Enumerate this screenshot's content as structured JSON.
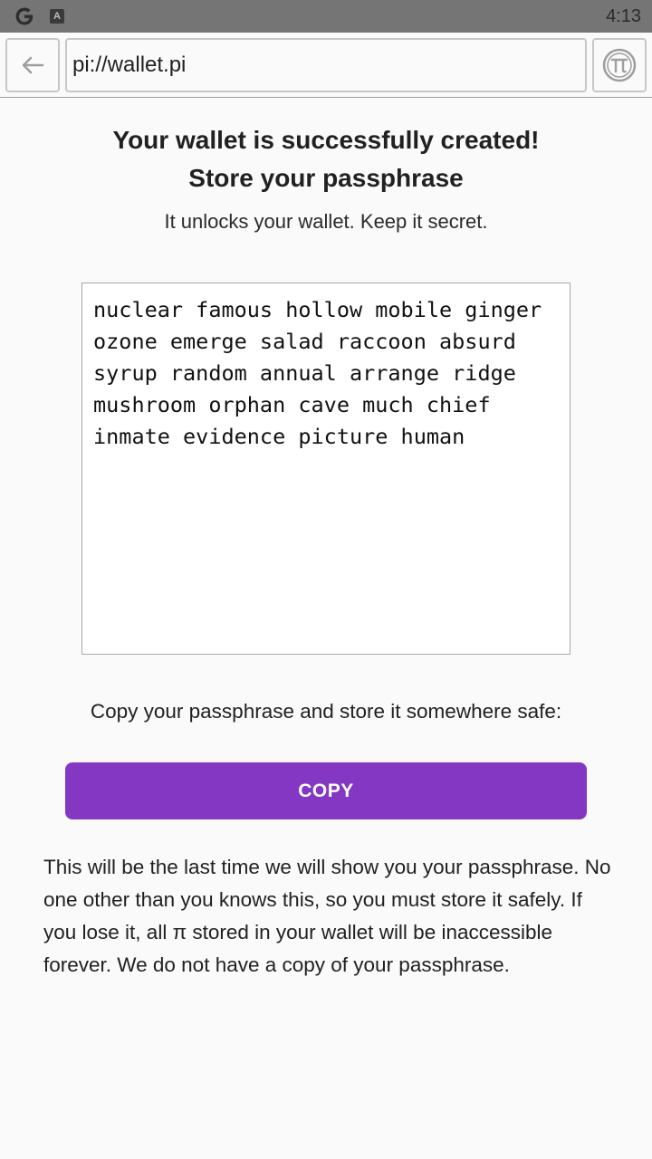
{
  "status_bar": {
    "time": "4:13",
    "icons": [
      "google-icon",
      "app-a-icon"
    ],
    "notif_letter": "A"
  },
  "browser": {
    "url": "pi://wallet.pi",
    "back_icon": "arrow-left-icon",
    "pi_icon": "pi-logo-icon"
  },
  "page": {
    "title_line1": "Your wallet is successfully created!",
    "title_line2": "Store your passphrase",
    "subtitle": "It unlocks your wallet. Keep it secret.",
    "passphrase": "nuclear famous hollow mobile ginger ozone emerge salad raccoon absurd syrup random annual arrange ridge mushroom orphan cave much chief inmate evidence picture human",
    "copy_hint": "Copy your passphrase and store it somewhere safe:",
    "copy_label": "COPY",
    "warning": "This will be the last time we will show you your passphrase. No one other than you knows this, so you must store it safely. If you lose it, all π stored in your wallet will be inaccessible forever. We do not have a copy of your passphrase.",
    "accent_color": "#8437c2"
  }
}
